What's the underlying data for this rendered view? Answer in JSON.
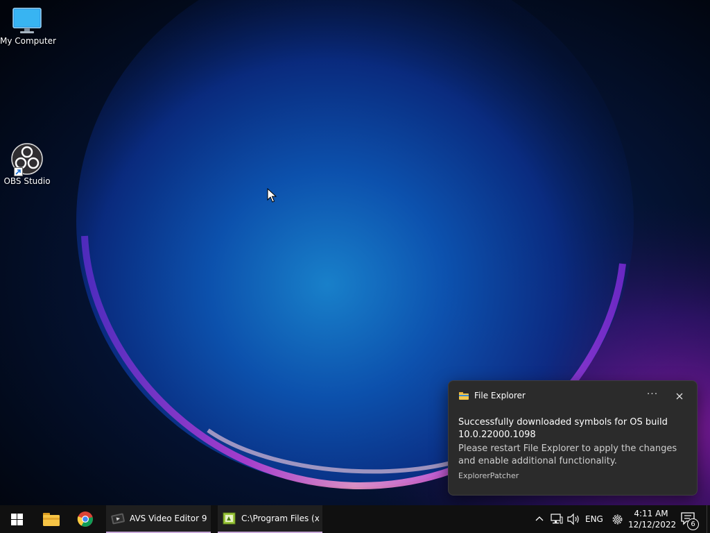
{
  "desktop": {
    "icons": [
      {
        "label": "My Computer",
        "icon": "monitor-icon"
      },
      {
        "label": "OBS Studio",
        "icon": "obs-studio-icon"
      }
    ]
  },
  "notification": {
    "app_name": "File Explorer",
    "more_label": "···",
    "title": "Successfully downloaded symbols for OS build 10.0.22000.1098",
    "body": "Please restart File Explorer to apply the changes and enable additional functionality.",
    "attribution": "ExplorerPatcher"
  },
  "taskbar": {
    "pinned": [
      {
        "icon": "windows-start-icon"
      },
      {
        "icon": "file-explorer-icon"
      },
      {
        "icon": "chrome-icon"
      }
    ],
    "tasks": [
      {
        "label": "AVS Video Editor 9....",
        "icon": "avs-video-editor-icon"
      },
      {
        "label": "C:\\Program Files (x...",
        "icon": "setup-installer-icon"
      }
    ],
    "tray": {
      "language": "ENG",
      "time": "4:11 AM",
      "date": "12/12/2022",
      "notification_count": "6"
    }
  },
  "colors": {
    "taskbar_bg": "#101010",
    "toast_bg": "#2b2b2b",
    "active_task_accent": "#c6a7d8"
  }
}
